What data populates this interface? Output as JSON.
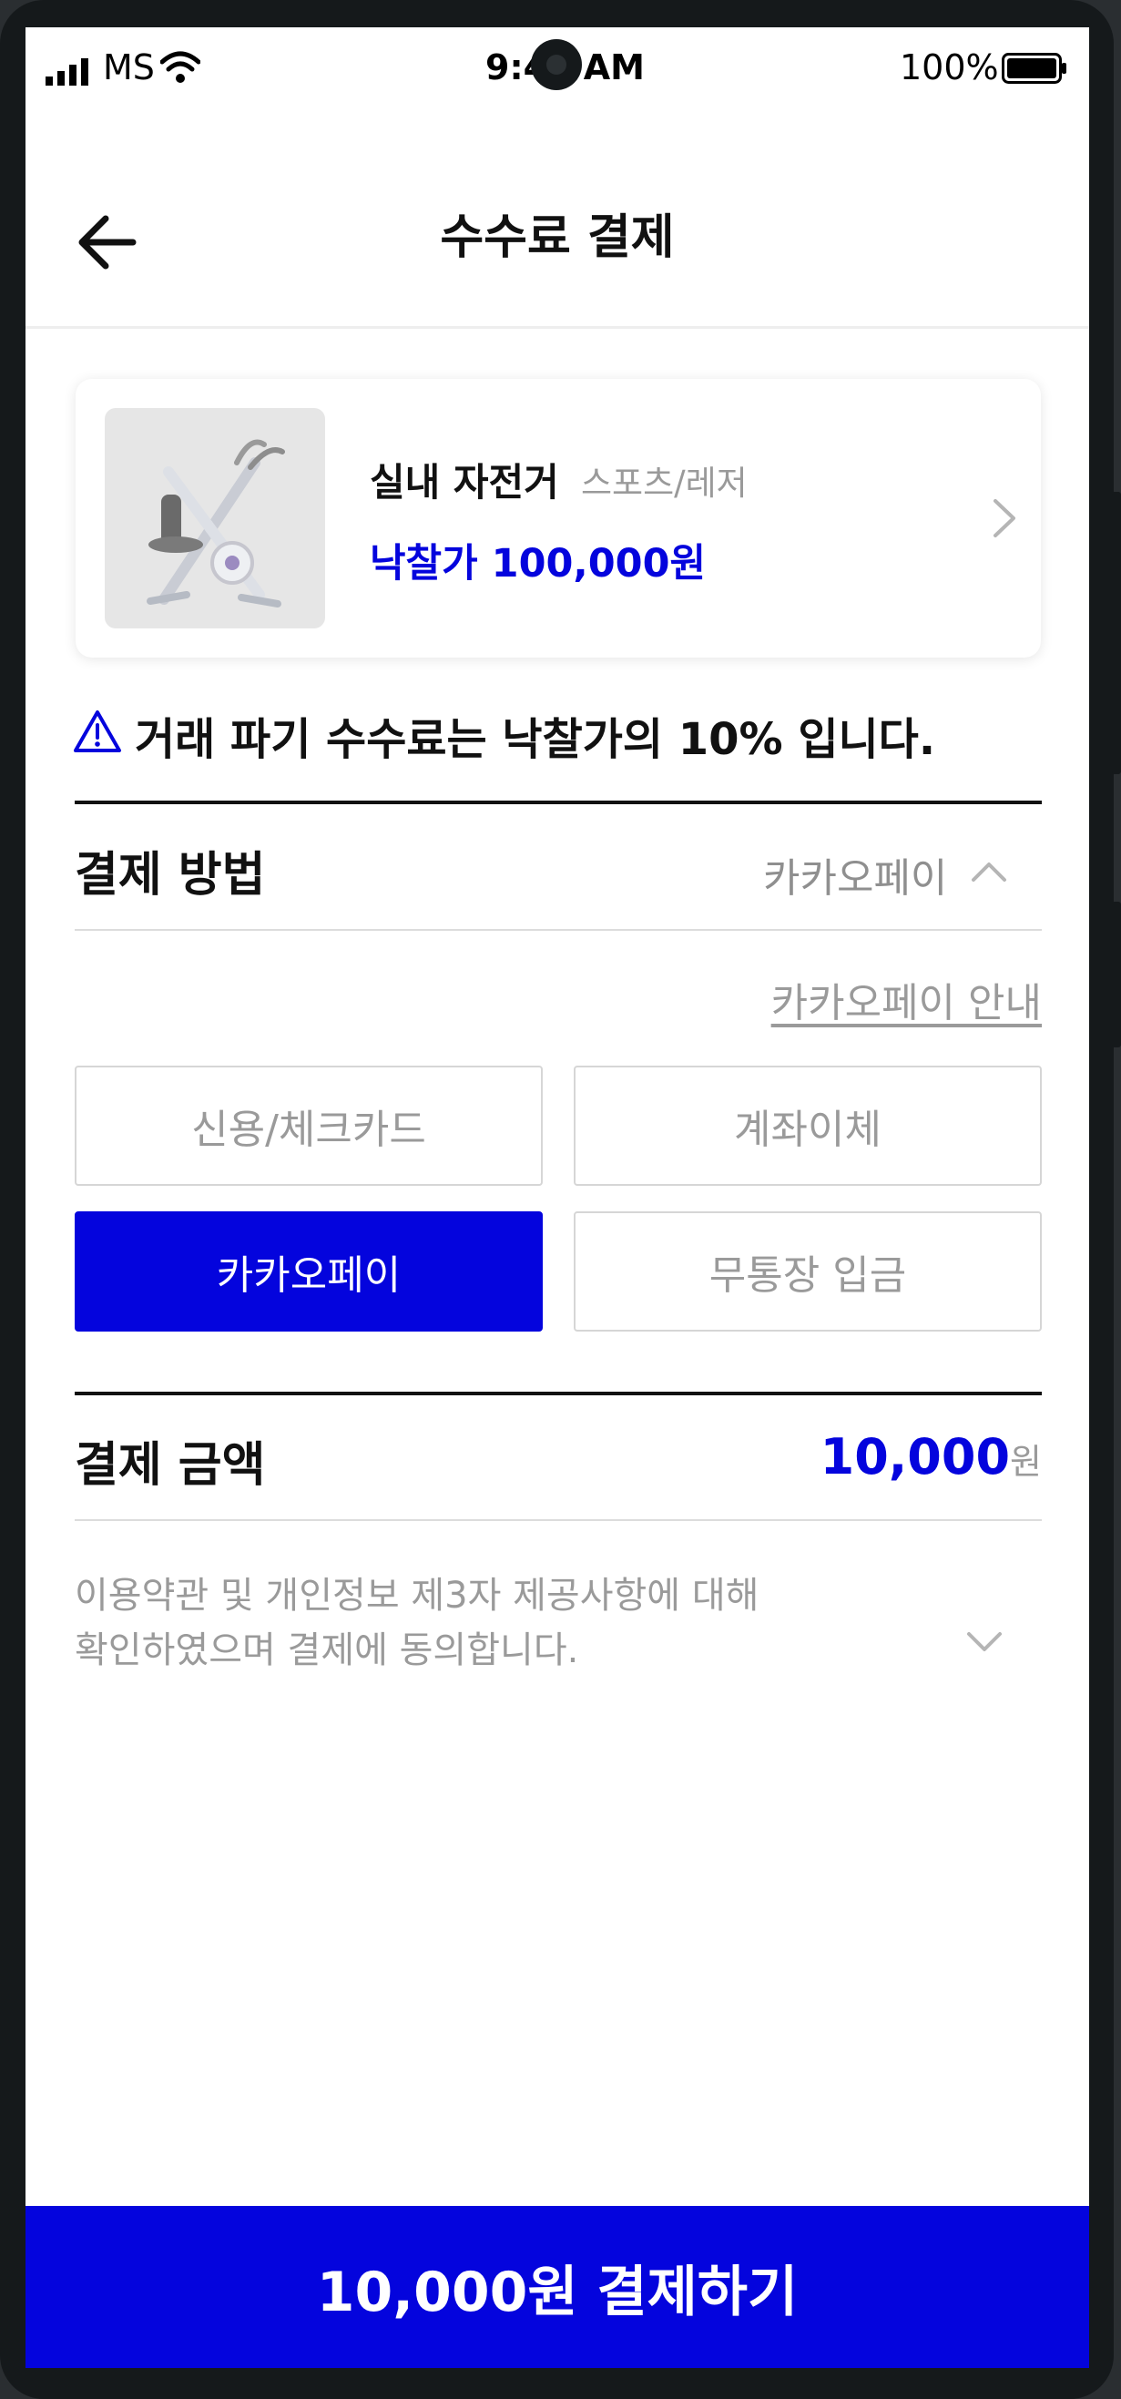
{
  "status_bar": {
    "carrier": "MS",
    "time": "9:41 AM",
    "battery": "100%"
  },
  "header": {
    "title": "수수료 결제"
  },
  "product": {
    "name": "실내 자전거",
    "category": "스포츠/레저",
    "price": "낙찰가 100,000원"
  },
  "notice": {
    "text": "거래 파기 수수료는 낙찰가의 10% 입니다."
  },
  "payment_method": {
    "label": "결제 방법",
    "selected": "카카오페이",
    "guide_link": "카카오페이 안내",
    "options": [
      {
        "label": "신용/체크카드",
        "active": false
      },
      {
        "label": "계좌이체",
        "active": false
      },
      {
        "label": "카카오페이",
        "active": true
      },
      {
        "label": "무통장 입금",
        "active": false
      }
    ]
  },
  "payment_amount": {
    "label": "결제 금액",
    "value": "10,000",
    "unit": "원"
  },
  "agreement": {
    "line1": "이용약관 및 개인정보 제3자 제공사항에 대해",
    "line2": "확인하였으며 결제에 동의합니다."
  },
  "pay_button": {
    "label": "10,000원 결제하기"
  },
  "colors": {
    "accent": "#0404dd",
    "muted_text": "#9a9a9a"
  }
}
